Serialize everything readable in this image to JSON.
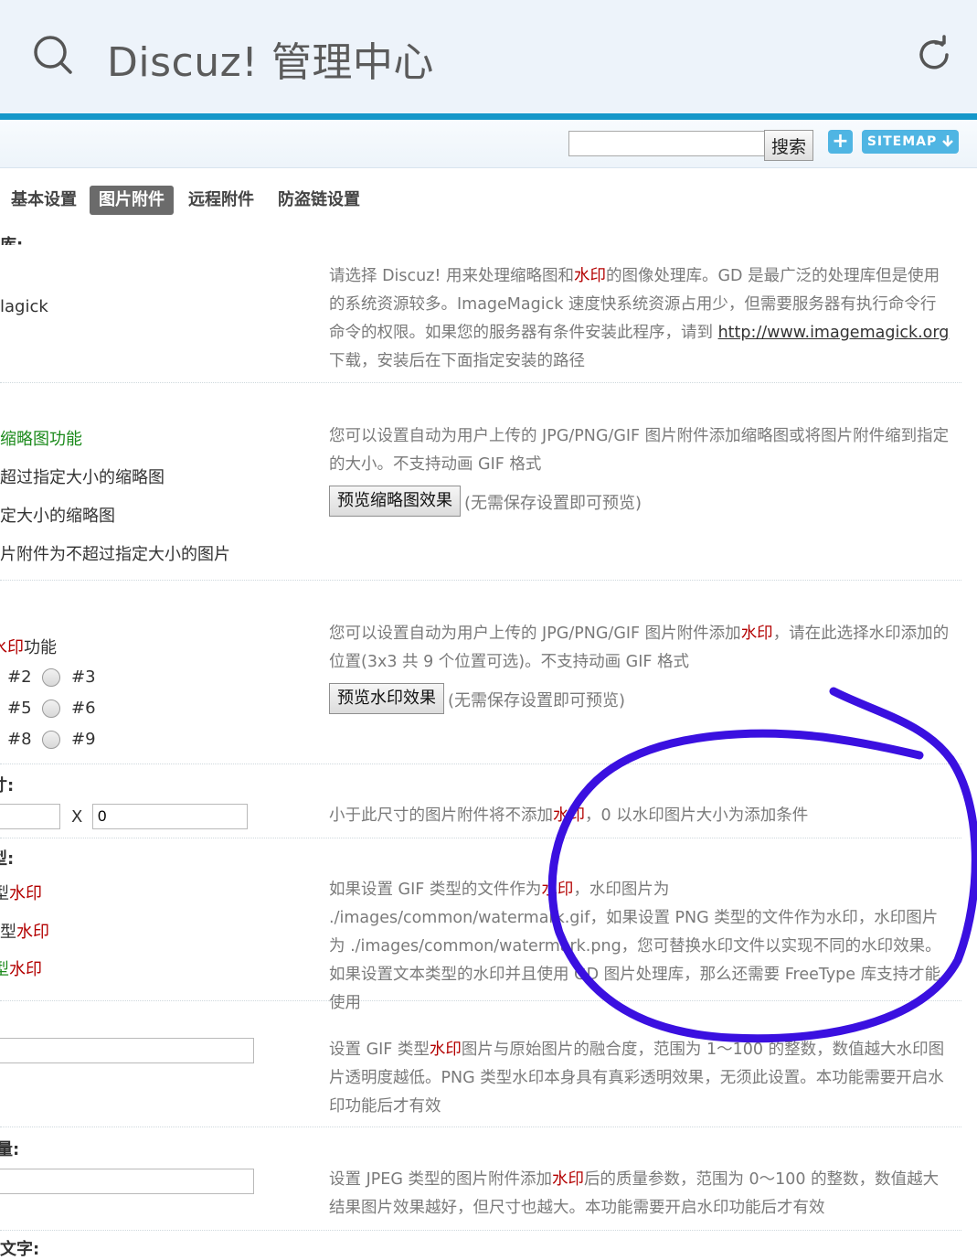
{
  "browser": {
    "title": "Discuz! 管理中心"
  },
  "toolbar": {
    "search_value": "",
    "search_button": "搜索",
    "plus": "+",
    "sitemap": "SITEMAP"
  },
  "tabs": [
    "基本设置",
    "图片附件",
    "远程附件",
    "防盗链设置"
  ],
  "section1": {
    "label_cut": "库:",
    "option_cut": "lagick",
    "desc_a": "请选择 Discuz! 用来处理缩略图和",
    "desc_red": "水印",
    "desc_b": "的图像处理库。GD 是最广泛的处理库但是使用的系统资源较多。ImageMagick 速度快系统资源占用少，但需要服务器有执行命令行命令的权限。如果您的服务器有条件安装此程序，请到 ",
    "desc_link": "http://www.imagemagick.org",
    "desc_c": " 下载，安装后在下面指定安装的路径"
  },
  "section2": {
    "option1": "缩略图功能",
    "option2": "超过指定大小的缩略图",
    "option3": "定大小的缩略图",
    "option4": "片附件为不超过指定大小的图片",
    "desc": "您可以设置自动为用户上传的 JPG/PNG/GIF 图片附件添加缩略图或将图片附件缩到指定的大小。不支持动画 GIF 格式",
    "preview_button": "预览缩略图效果",
    "note": "(无需保存设置即可预览)"
  },
  "section3": {
    "label_red": "水印",
    "label_b": "功能",
    "pos": [
      "#2",
      "#3",
      "#5",
      "#6",
      "#8",
      "#9"
    ],
    "desc_a": "您可以设置自动为用户上传的 JPG/PNG/GIF 图片附件添加",
    "desc_red": "水印",
    "desc_b": "，请在此选择水印添加的位置(3x3 共 9 个位置可选)。不支持动画 GIF 格式",
    "preview_button": "预览水印效果",
    "note": "(无需保存设置即可预览)"
  },
  "section4": {
    "label_cut": "寸:",
    "x_label": "X",
    "width_value": "",
    "height_value": "0",
    "desc_a": "小于此尺寸的图片附件将不添加",
    "desc_red": "水印",
    "desc_b": "，0 以水印图片大小为添加条件"
  },
  "section5": {
    "label_cut": "型:",
    "opt1_a": "型",
    "opt1_red": "水印",
    "opt2_a": "类型",
    "opt2_red": "水印",
    "opt3_a": "型",
    "opt3_red": "水印",
    "desc_a": "如果设置 GIF 类型的文件作为",
    "desc_red1": "水印",
    "desc_b": "，水印图片为 ./images/common/watermark.gif，如果设置 PNG 类型的文件作为",
    "desc_red2": "水印",
    "desc_c": "，水印图片为 ./images/common/watermark.png，您可替换水印文件以实现不同的",
    "desc_red3": "水印",
    "desc_d": "效果。如果设置文本类型的水印并且使用 GD 图片处理库，那么还需要 FreeType 库支持才能使用"
  },
  "section6": {
    "value": "",
    "desc_a": "设置 GIF 类型",
    "desc_red": "水印",
    "desc_b": "图片与原始图片的融合度，范围为 1～100 的整数，数值越大水印图片透明度越低。PNG 类型水印本身具有真彩透明效果，无须此设置。本功能需要开启水印功能后才有效"
  },
  "section7": {
    "label_cut": "量:",
    "value": "",
    "desc_a": "设置 JPEG 类型的图片附件添加",
    "desc_red": "水印",
    "desc_b": "后的质量参数，范围为 0～100 的整数，数值越大结果图片效果越好，但尺寸也越大。本功能需要开启水印功能后才有效"
  },
  "section8": {
    "label_cut": "文字:"
  },
  "colors": {
    "accent": "#1597c9",
    "button": "#4fb5e3",
    "annotation": "#3a10e0",
    "red_text": "#b30000",
    "green_text": "#1b8a1b"
  }
}
